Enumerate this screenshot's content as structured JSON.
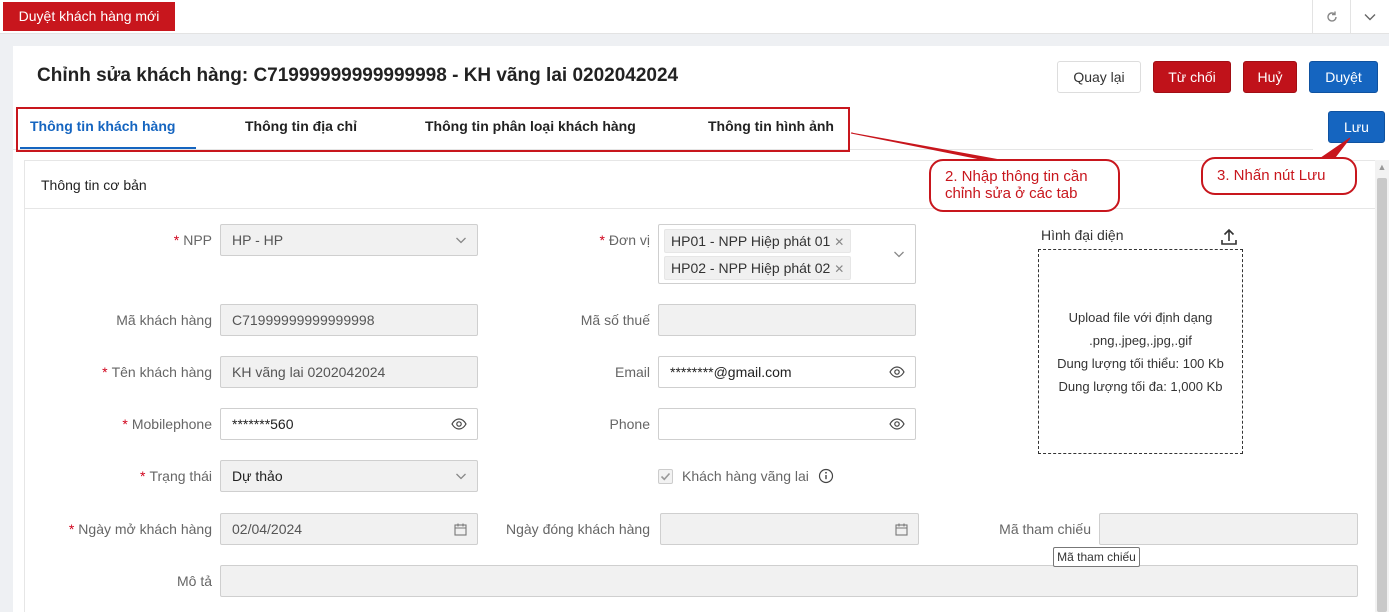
{
  "app_tab": {
    "label": "Duyệt khách hàng mới"
  },
  "header": {
    "title": "Chỉnh sửa khách hàng: C71999999999999998 - KH vãng lai 0202042024",
    "buttons": {
      "back": "Quay lại",
      "reject": "Từ chối",
      "cancel": "Huỷ",
      "approve": "Duyệt",
      "save": "Lưu"
    }
  },
  "tabs": [
    {
      "label": "Thông tin khách hàng",
      "active": true
    },
    {
      "label": "Thông tin địa chỉ",
      "active": false
    },
    {
      "label": "Thông tin phân loại khách hàng",
      "active": false
    },
    {
      "label": "Thông tin hình ảnh",
      "active": false
    }
  ],
  "section": {
    "title": "Thông tin cơ bản"
  },
  "form": {
    "npp": {
      "label": "NPP",
      "value": "HP - HP",
      "required": true
    },
    "don_vi": {
      "label": "Đơn vị",
      "required": true,
      "tags": [
        "HP01 - NPP Hiệp phát 01",
        "HP02 - NPP Hiệp phát 02"
      ]
    },
    "ma_khach_hang": {
      "label": "Mã khách hàng",
      "value": "C71999999999999998"
    },
    "ma_so_thue": {
      "label": "Mã số thuế",
      "value": ""
    },
    "ten_khach_hang": {
      "label": "Tên khách hàng",
      "value": "KH vãng lai 0202042024",
      "required": true
    },
    "email": {
      "label": "Email",
      "value": "********@gmail.com"
    },
    "mobilephone": {
      "label": "Mobilephone",
      "value": "*******560",
      "required": true
    },
    "phone": {
      "label": "Phone",
      "value": ""
    },
    "trang_thai": {
      "label": "Trạng thái",
      "value": "Dự thảo",
      "required": true
    },
    "khach_hang_vang_lai": {
      "label": "Khách hàng vãng lai",
      "checked": true
    },
    "ngay_mo": {
      "label": "Ngày mở khách hàng",
      "value": "02/04/2024",
      "required": true
    },
    "ngay_dong": {
      "label": "Ngày đóng khách hàng",
      "value": ""
    },
    "ma_tham_chieu": {
      "label": "Mã tham chiếu",
      "value": "",
      "tooltip": "Mã tham chiếu"
    },
    "mo_ta": {
      "label": "Mô tả",
      "value": ""
    }
  },
  "avatar": {
    "label": "Hình đại diện",
    "lines": [
      "Upload file với định dạng .png,.jpeg,.jpg,.gif",
      "Dung lượng tối thiểu: 100 Kb",
      "Dung lượng tối đa: 1,000 Kb"
    ]
  },
  "callouts": {
    "step2": "2. Nhập thông tin cần chỉnh sửa ở các tab",
    "step3": "3. Nhấn nút Lưu"
  },
  "colors": {
    "brand_red": "#c8161d",
    "primary_blue": "#1565c0"
  }
}
